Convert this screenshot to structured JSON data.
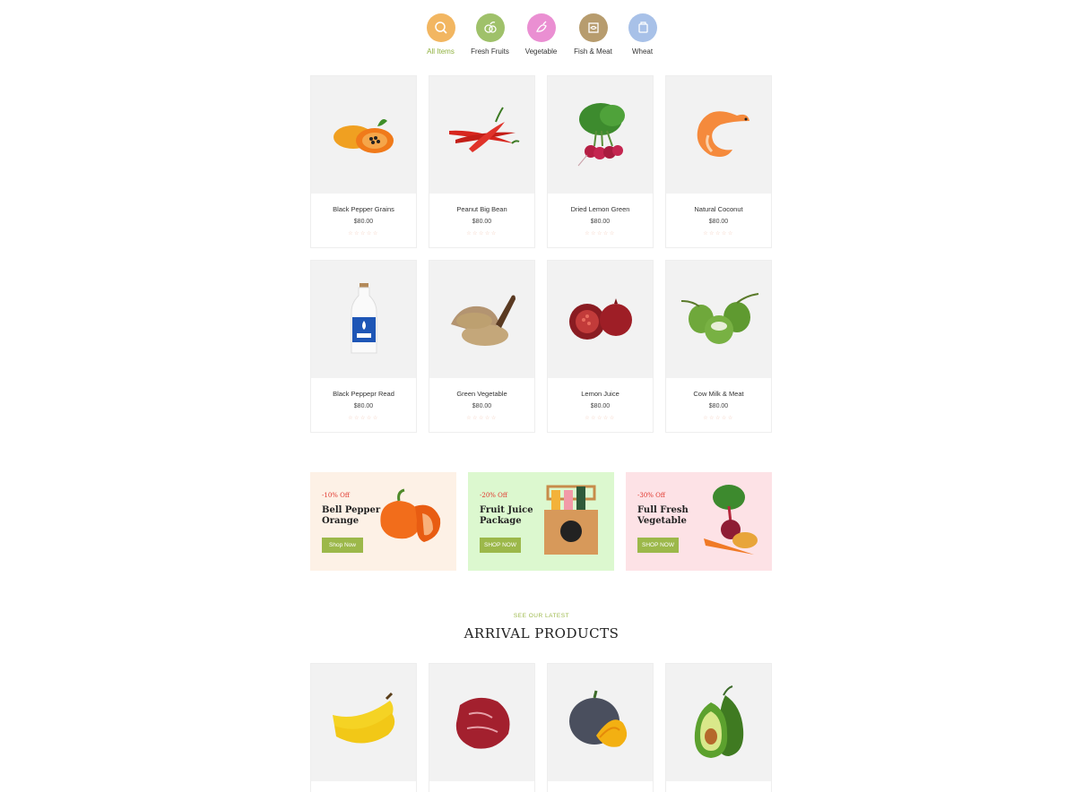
{
  "categories": [
    {
      "label": "All Items",
      "icon": "search-basket-icon",
      "color": "#f2b661",
      "active": true
    },
    {
      "label": "Fresh Fruits",
      "icon": "fruits-icon",
      "color": "#9fc16a",
      "active": false
    },
    {
      "label": "Vegetable",
      "icon": "vegetable-icon",
      "color": "#ea8fd2",
      "active": false
    },
    {
      "label": "Fish & Meat",
      "icon": "fish-meat-icon",
      "color": "#b79c6e",
      "active": false
    },
    {
      "label": "Wheat",
      "icon": "wheat-icon",
      "color": "#a8c1e8",
      "active": false
    }
  ],
  "products": [
    {
      "name": "Black Pepper Grains",
      "price": "$80.00",
      "image": "papaya"
    },
    {
      "name": "Peanut Big Bean",
      "price": "$80.00",
      "image": "chili-peppers"
    },
    {
      "name": "Dried Lemon Green",
      "price": "$80.00",
      "image": "radishes"
    },
    {
      "name": "Natural Coconut",
      "price": "$80.00",
      "image": "shrimp"
    },
    {
      "name": "Black Peppepr Read",
      "price": "$80.00",
      "image": "milk-bottle"
    },
    {
      "name": "Green Vegetable",
      "price": "$80.00",
      "image": "grain-sack"
    },
    {
      "name": "Lemon Juice",
      "price": "$80.00",
      "image": "pomegranate"
    },
    {
      "name": "Cow Milk & Meat",
      "price": "$80.00",
      "image": "green-coconuts"
    }
  ],
  "stars": "☆☆☆☆☆",
  "banners": [
    {
      "off": "-10% Off",
      "title_line1": "Bell Pepper",
      "title_line2": "Orange",
      "button": "Shop Now",
      "bg": "#fdf1e6"
    },
    {
      "off": "-20% Off",
      "title_line1": "Fruit Juice",
      "title_line2": "Package",
      "button": "SHOP NOW",
      "bg": "#dcf8cf"
    },
    {
      "off": "-30% Off",
      "title_line1": "Full Fresh",
      "title_line2": "Vegetable",
      "button": "SHOP NOW",
      "bg": "#fde2e6"
    }
  ],
  "arrival": {
    "subtitle": "SEE OUR LATEST",
    "title": "ARRIVAL PRODUCTS",
    "items": [
      {
        "image": "bananas"
      },
      {
        "image": "raw-meat"
      },
      {
        "image": "pumpkin"
      },
      {
        "image": "avocado"
      }
    ]
  },
  "colors": {
    "accent": "#9cb84a",
    "discount": "#e0352b",
    "card_bg": "#f2f2f2"
  }
}
